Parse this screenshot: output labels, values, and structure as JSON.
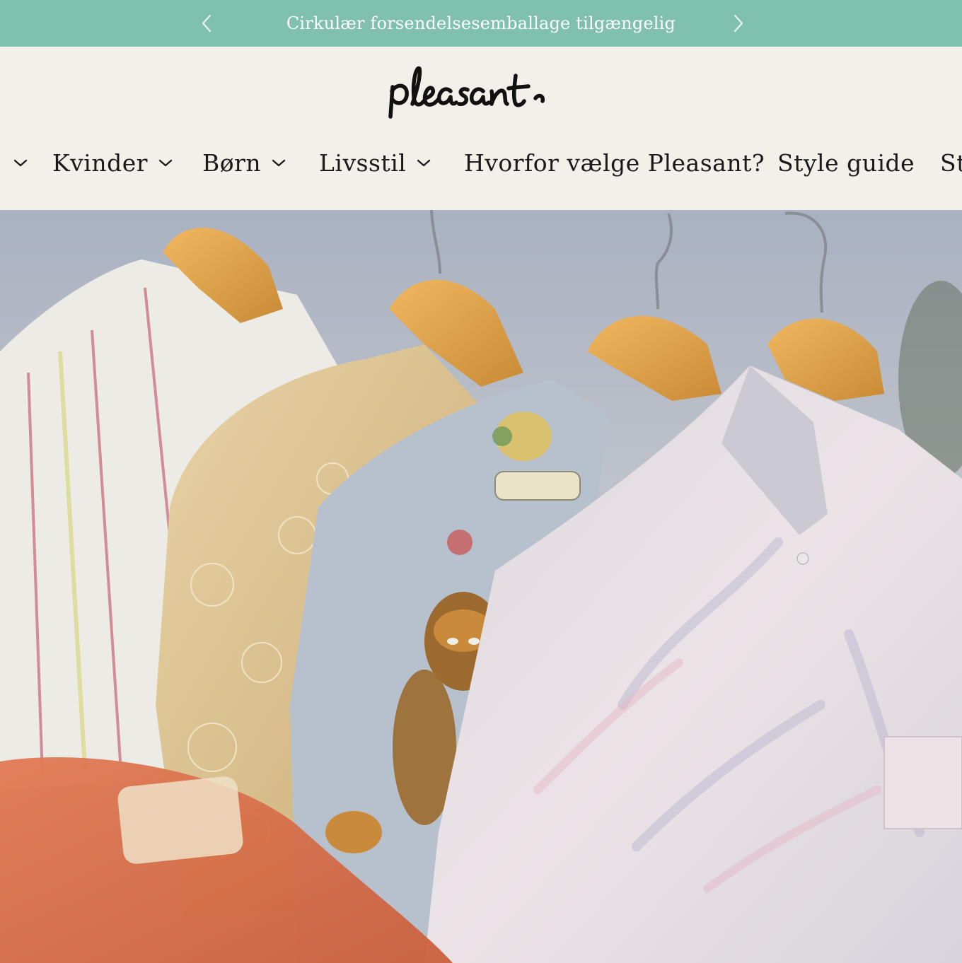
{
  "announcement": {
    "text": "Cirkulær forsendelsesemballage tilgængelig",
    "prev_icon": "chevron-left-icon",
    "next_icon": "chevron-right-icon"
  },
  "brand": {
    "logo_text": "pleasant"
  },
  "nav": {
    "items": [
      {
        "label": "",
        "has_dropdown": true
      },
      {
        "label": "Kvinder",
        "has_dropdown": true
      },
      {
        "label": "Børn",
        "has_dropdown": true
      },
      {
        "label": "Livsstil",
        "has_dropdown": true
      },
      {
        "label": "Hvorfor vælge Pleasant?",
        "has_dropdown": false
      },
      {
        "label": "Style guide",
        "has_dropdown": false
      },
      {
        "label": "St",
        "has_dropdown": false
      }
    ]
  },
  "colors": {
    "announcement_bg": "#7fc0ae",
    "page_bg": "#f3f0ea",
    "text": "#1a1a1a"
  }
}
